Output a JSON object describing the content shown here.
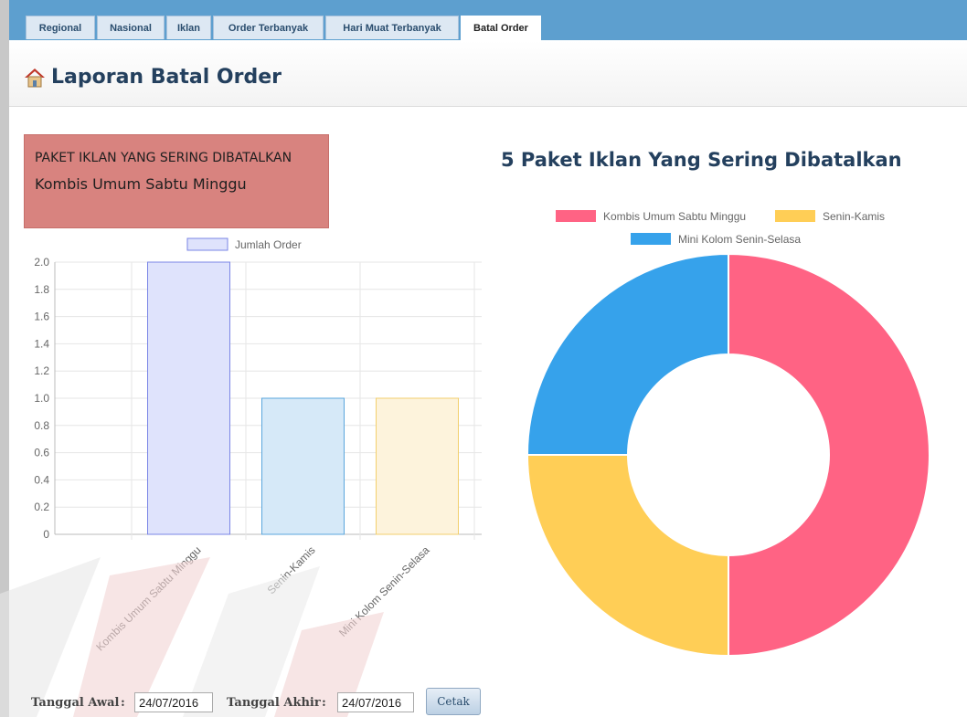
{
  "tabs": [
    "Regional",
    "Nasional",
    "Iklan",
    "Order Terbanyak",
    "Hari Muat Terbanyak",
    "Batal Order"
  ],
  "active_tab": "Batal Order",
  "page_title": "Laporan Batal Order",
  "infobox": {
    "caption": "PAKET IKLAN YANG SERING DIBATALKAN",
    "value": "Kombis Umum Sabtu Minggu"
  },
  "form": {
    "start_label": "Tanggal Awal",
    "separator": ":",
    "start_value": "24/07/2016",
    "end_label": "Tanggal Akhir",
    "end_value": "24/07/2016",
    "print_button": "Cetak"
  },
  "icons": [
    "home-icon"
  ],
  "chart_data": [
    {
      "type": "bar",
      "legend": [
        "Jumlah Order"
      ],
      "categories": [
        "Kombis Umum Sabtu Minggu",
        "Senin-Kamis",
        "Mini Kolom Senin-Selasa"
      ],
      "series": [
        {
          "name": "Jumlah Order",
          "values": [
            2,
            1,
            1
          ]
        }
      ],
      "yticks": [
        "2.0",
        "1.8",
        "1.6",
        "1.4",
        "1.2",
        "1.0",
        "0.8",
        "0.6",
        "0.4",
        "0.2",
        "0"
      ],
      "ylim": [
        0,
        2
      ],
      "grid": true,
      "legend_position": "top",
      "bar_colors": [
        "#dfe3fc",
        "#d6e9f8",
        "#fdf3dc"
      ],
      "bar_border_colors": [
        "#7a85e6",
        "#5aa6dc",
        "#f2cf6e"
      ]
    },
    {
      "type": "pie",
      "title": "5 Paket Iklan Yang Sering Dibatalkan",
      "labels": [
        "Kombis Umum Sabtu Minggu",
        "Senin-Kamis",
        "Mini Kolom Senin-Selasa"
      ],
      "values": [
        2,
        1,
        1
      ],
      "colors": [
        "#ff6384",
        "#ffce56",
        "#36a2eb"
      ],
      "legend_position": "top"
    }
  ]
}
